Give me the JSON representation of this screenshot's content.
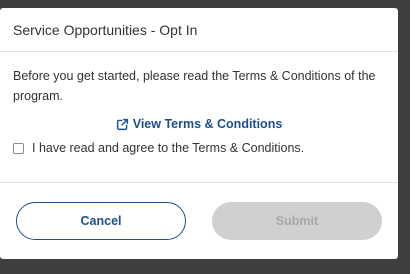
{
  "modal": {
    "title": "Service Opportunities - Opt In",
    "body_text": "Before you get started, please read the Terms & Conditions of the program.",
    "terms_link_label": "View Terms & Conditions",
    "agree_label": "I have read and agree to the Terms & Conditions.",
    "agree_checked": false,
    "cancel_label": "Cancel",
    "submit_label": "Submit",
    "submit_enabled": false
  },
  "colors": {
    "overlay": "#3f3f3f",
    "accent": "#1f4e8c",
    "disabled_bg": "#d0d0d0",
    "disabled_text": "#a8a8a8"
  },
  "icons": {
    "terms_link": "external-link-icon"
  }
}
